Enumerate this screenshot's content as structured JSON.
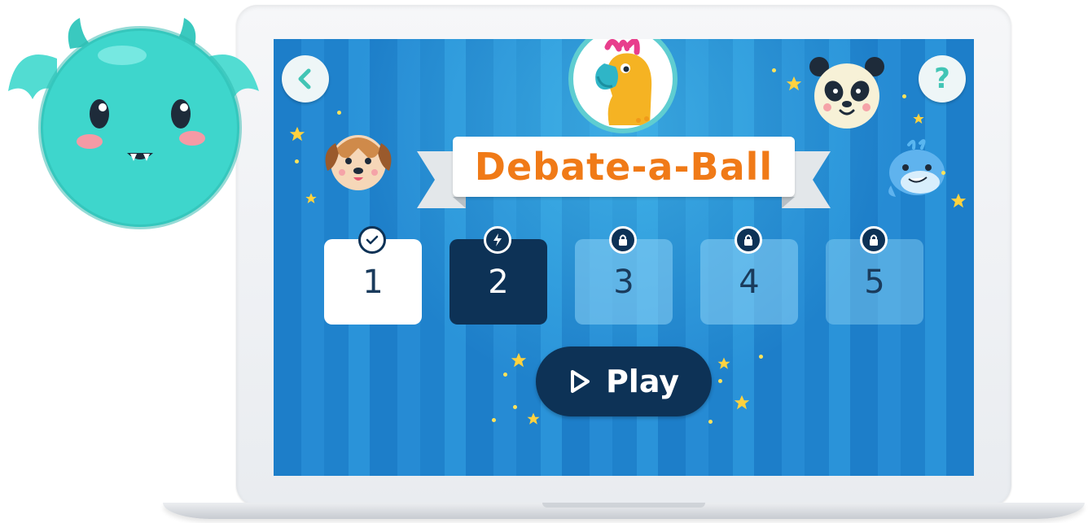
{
  "app": {
    "title": "Debate-a-Ball"
  },
  "nav": {
    "back_icon": "chevron-left-icon",
    "help_label": "?"
  },
  "levels": [
    {
      "label": "1",
      "state": "completed",
      "badge_icon": "check-icon"
    },
    {
      "label": "2",
      "state": "current",
      "badge_icon": "lightning-icon"
    },
    {
      "label": "3",
      "state": "locked",
      "badge_icon": "lock-icon"
    },
    {
      "label": "4",
      "state": "locked",
      "badge_icon": "lock-icon"
    },
    {
      "label": "5",
      "state": "locked",
      "badge_icon": "lock-icon"
    }
  ],
  "play": {
    "label": "Play",
    "icon": "play-icon"
  },
  "colors": {
    "title_orange": "#f07a17",
    "dark_navy": "#0d3256",
    "background_blue": "#1d7ec9",
    "accent_teal": "#42c5b5",
    "star_yellow": "#ffd23f"
  }
}
